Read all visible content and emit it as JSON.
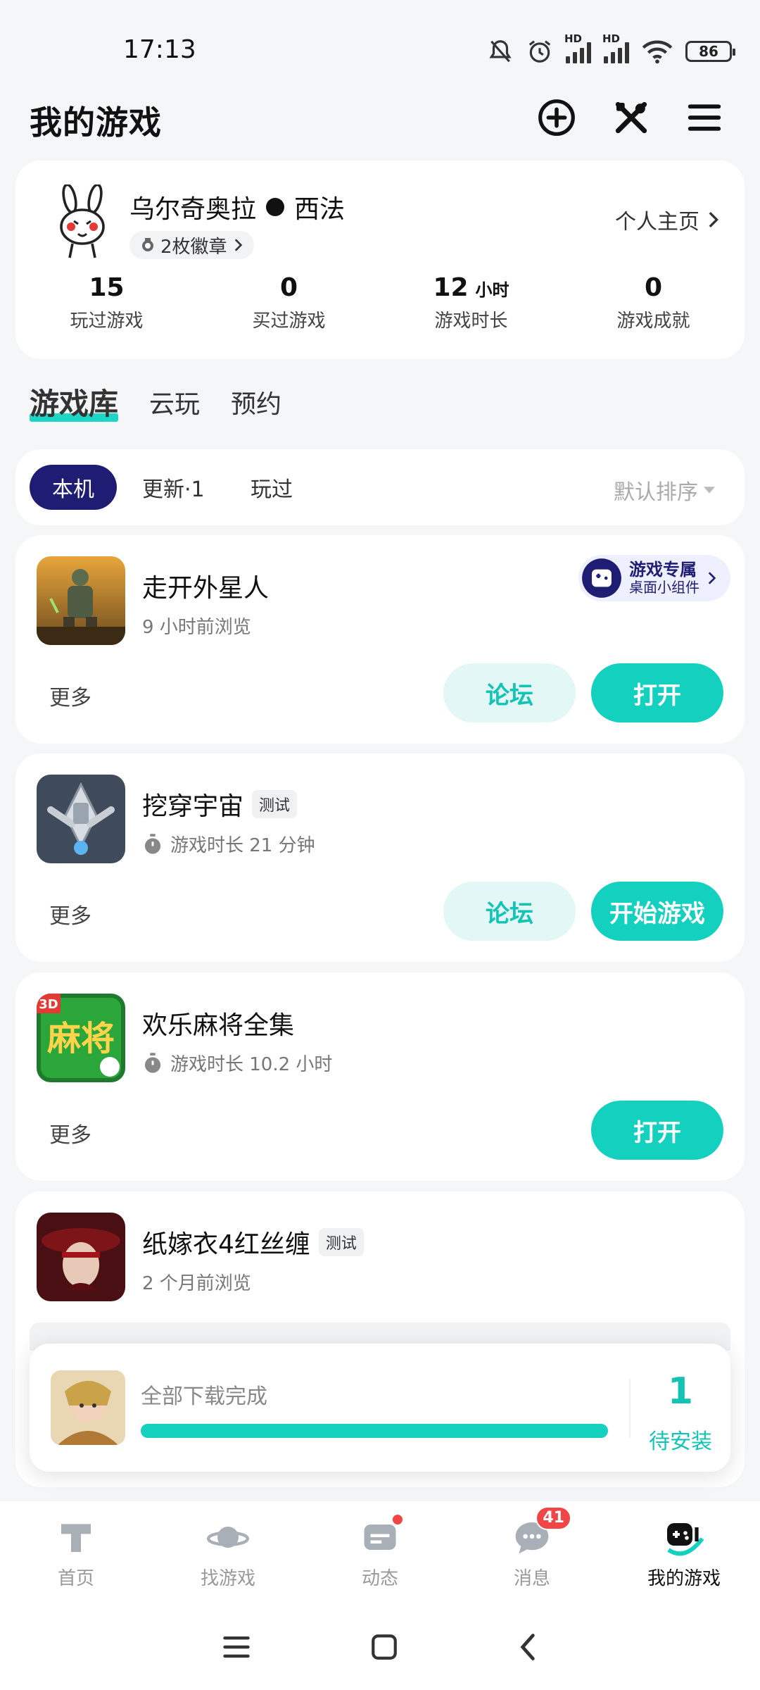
{
  "status": {
    "time": "17:13",
    "battery": "86",
    "hd1": "HD",
    "hd2": "HD"
  },
  "header": {
    "title": "我的游戏"
  },
  "profile": {
    "username": "乌尔奇奥拉",
    "server": "西法",
    "badges": "2枚徽章",
    "profile_link": "个人主页",
    "stats": [
      {
        "value": "15",
        "unit": "",
        "label": "玩过游戏"
      },
      {
        "value": "0",
        "unit": "",
        "label": "买过游戏"
      },
      {
        "value": "12",
        "unit": "小时",
        "label": "游戏时长"
      },
      {
        "value": "0",
        "unit": "",
        "label": "游戏成就"
      }
    ]
  },
  "section_tabs": [
    "游戏库",
    "云玩",
    "预约"
  ],
  "filters": {
    "chips": [
      "本机",
      "更新·1",
      "玩过"
    ],
    "sort": "默认排序"
  },
  "widget": {
    "line1": "游戏专属",
    "line2": "桌面小组件"
  },
  "games": [
    {
      "name": "走开外星人",
      "tag": "",
      "sub": "9 小时前浏览",
      "more": "更多",
      "forum": "论坛",
      "action": "打开"
    },
    {
      "name": "挖穿宇宙",
      "tag": "测试",
      "sub": "游戏时长 21 分钟",
      "more": "更多",
      "forum": "论坛",
      "action": "开始游戏"
    },
    {
      "name": "欢乐麻将全集",
      "tag": "",
      "sub": "游戏时长 10.2 小时",
      "more": "更多",
      "forum": "",
      "action": "打开"
    },
    {
      "name": "纸嫁衣4红丝缠",
      "tag": "测试",
      "sub": "2 个月前浏览"
    }
  ],
  "mahjong_icon": {
    "big": "麻将",
    "badge": "3D"
  },
  "download": {
    "text": "全部下载完成",
    "progress": 1.0,
    "count": "1",
    "label": "待安装"
  },
  "bottom_nav": [
    {
      "label": "首页"
    },
    {
      "label": "找游戏"
    },
    {
      "label": "动态"
    },
    {
      "label": "消息",
      "badge": "41"
    },
    {
      "label": "我的游戏"
    }
  ]
}
